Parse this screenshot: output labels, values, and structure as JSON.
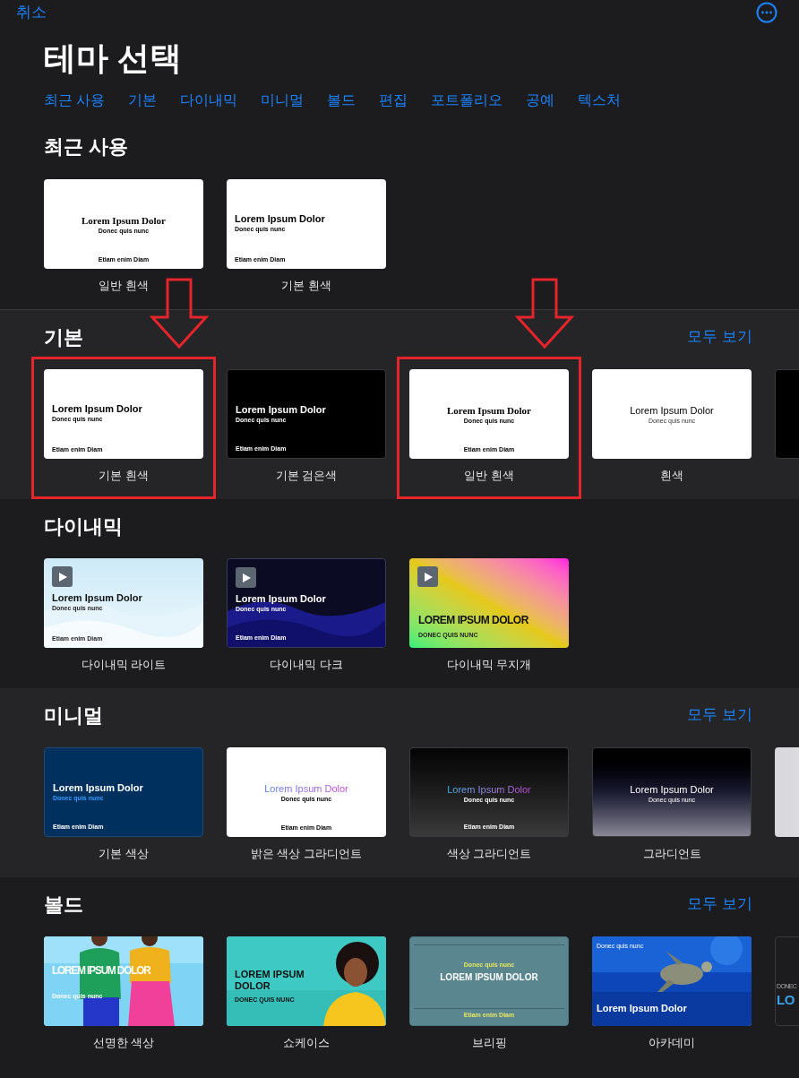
{
  "top_bar": {
    "cancel": "취소"
  },
  "title": "테마 선택",
  "categories": [
    "최근 사용",
    "기본",
    "다이내믹",
    "미니멀",
    "볼드",
    "편집",
    "포트폴리오",
    "공예",
    "텍스처"
  ],
  "sections": [
    {
      "title": "최근 사용",
      "themes": [
        {
          "label": "일반 흰색",
          "kind": "white-serif",
          "title": "Lorem Ipsum Dolor",
          "subtitle": "Donec quis nunc",
          "footer": "Etiam enim Diam",
          "highlighted": false
        },
        {
          "label": "기본 흰색",
          "kind": "white-left",
          "title": "Lorem Ipsum Dolor",
          "subtitle": "Donec quis nunc",
          "footer": "Etiam enim Diam",
          "highlighted": false
        }
      ]
    },
    {
      "title": "기본",
      "see_all": "모두 보기",
      "themes": [
        {
          "label": "기본 흰색",
          "kind": "white-left",
          "title": "Lorem Ipsum Dolor",
          "subtitle": "Donec quis nunc",
          "footer": "Etiam enim Diam",
          "highlighted": true
        },
        {
          "label": "기본 검은색",
          "kind": "black-left",
          "title": "Lorem Ipsum Dolor",
          "subtitle": "Donec quis nunc",
          "footer": "Etiam enim Diam",
          "highlighted": false
        },
        {
          "label": "일반 흰색",
          "kind": "white-serif",
          "title": "Lorem Ipsum Dolor",
          "subtitle": "Donec quis nunc",
          "footer": "Etiam enim Diam",
          "highlighted": true
        },
        {
          "label": "흰색",
          "kind": "white-center",
          "title": "Lorem Ipsum Dolor",
          "subtitle": "Donec quis nunc",
          "highlighted": false
        },
        {
          "kind": "black-blank",
          "highlighted": false
        }
      ]
    },
    {
      "title": "다이내믹",
      "themes": [
        {
          "label": "다이내믹 라이트",
          "kind": "dynamic-light",
          "title": "Lorem Ipsum Dolor",
          "subtitle": "Donec quis nunc",
          "footer": "Etiam enim Diam",
          "highlighted": false
        },
        {
          "label": "다이내믹 다크",
          "kind": "dynamic-dark",
          "title": "Lorem Ipsum Dolor",
          "subtitle": "Donec quis nunc",
          "footer": "Etiam enim Diam",
          "highlighted": false
        },
        {
          "label": "다이내믹 무지개",
          "kind": "rainbow",
          "title": "LOREM IPSUM DOLOR",
          "subtitle": "DONEC QUIS NUNC",
          "highlighted": false
        }
      ]
    },
    {
      "title": "미니멀",
      "see_all": "모두 보기",
      "themes": [
        {
          "label": "기본 색상",
          "kind": "navy",
          "title": "Lorem Ipsum Dolor",
          "subtitle": "Donec quis nunc",
          "footer": "Etiam enim Diam",
          "highlighted": false
        },
        {
          "label": "밝은 색상 그라디언트",
          "kind": "light-gradient",
          "title": "Lorem Ipsum Dolor",
          "subtitle": "Donec quis nunc",
          "footer": "Etiam enim Diam",
          "highlighted": false
        },
        {
          "label": "색상 그라디언트",
          "kind": "dark-gradient",
          "title": "Lorem Ipsum Dolor",
          "subtitle": "Donec quis nunc",
          "footer": "Etiam enim Diam",
          "highlighted": false
        },
        {
          "label": "그라디언트",
          "kind": "gradient",
          "title": "Lorem Ipsum Dolor",
          "subtitle": "Donec quis nunc",
          "highlighted": false
        },
        {
          "kind": "light-grey",
          "highlighted": false
        }
      ]
    },
    {
      "title": "볼드",
      "see_all": "모두 보기",
      "themes": [
        {
          "label": "선명한 색상",
          "kind": "vivid",
          "title": "LOREM IPSUM DOLOR",
          "subtitle": "Donec quis nunc",
          "highlighted": false
        },
        {
          "label": "쇼케이스",
          "kind": "showcase",
          "title": "LOREM IPSUM DOLOR",
          "subtitle": "DONEC QUIS NUNC",
          "highlighted": false
        },
        {
          "label": "브리핑",
          "kind": "briefing",
          "title": "LOREM IPSUM DOLOR",
          "subtitle": "Donec quis nunc",
          "footer": "Etiam enim Diam",
          "highlighted": false
        },
        {
          "label": "아카데미",
          "kind": "academy",
          "title": "Lorem Ipsum Dolor",
          "subtitle": "Donec quis nunc",
          "highlighted": false
        },
        {
          "kind": "dark-partial",
          "title": "LO",
          "subtitle": "DONEC",
          "highlighted": false
        }
      ]
    }
  ]
}
